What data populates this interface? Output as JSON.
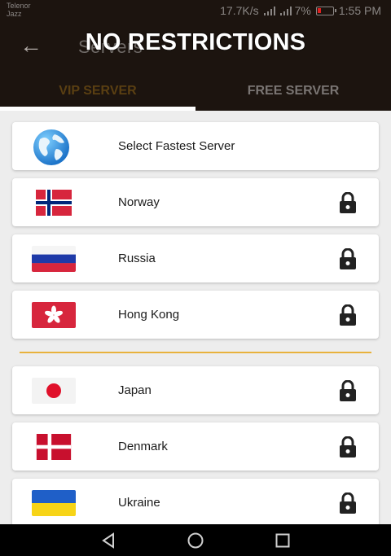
{
  "status_bar": {
    "carrier_line1": "Telenor",
    "carrier_line2": "Jazz",
    "speed": "17.7K/s",
    "battery": "7%",
    "time": "1:55 PM"
  },
  "header": {
    "faded_title": "Servers",
    "banner": "NO RESTRICTIONS"
  },
  "tabs": [
    {
      "label": "VIP SERVER",
      "active": true
    },
    {
      "label": "FREE SERVER",
      "active": false
    }
  ],
  "servers": [
    {
      "label": "Select Fastest Server",
      "icon": "globe-icon",
      "locked": false
    },
    {
      "label": "Norway",
      "icon": "norway-flag-icon",
      "locked": true
    },
    {
      "label": "Russia",
      "icon": "russia-flag-icon",
      "locked": true
    },
    {
      "label": "Hong Kong",
      "icon": "hong-kong-flag-icon",
      "locked": true
    },
    {
      "label": "Japan",
      "icon": "japan-flag-icon",
      "locked": true
    },
    {
      "label": "Denmark",
      "icon": "denmark-flag-icon",
      "locked": true
    },
    {
      "label": "Ukraine",
      "icon": "ukraine-flag-icon",
      "locked": true
    }
  ],
  "colors": {
    "app_bar": "#1c140f",
    "active_tab_text": "#5a3f12",
    "divider": "#e8b23c",
    "list_background": "#ededed"
  }
}
